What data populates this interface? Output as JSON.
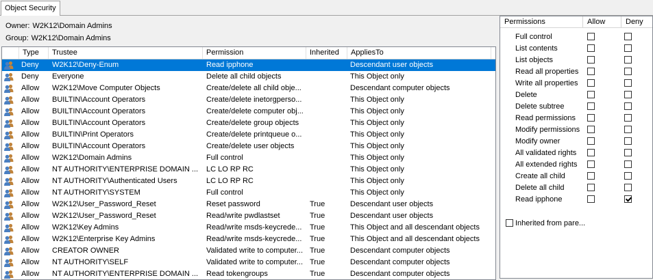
{
  "tab": {
    "label": "Object Security"
  },
  "owner": {
    "label": "Owner:",
    "value": "W2K12\\Domain Admins"
  },
  "group": {
    "label": "Group:",
    "value": "W2K12\\Domain Admins"
  },
  "columns": [
    "Type",
    "Trustee",
    "Permission",
    "Inherited",
    "AppliesTo"
  ],
  "rows": [
    {
      "type": "Deny",
      "trustee": "W2K12\\Deny-Enum",
      "permission": "Read ipphone",
      "inherited": "",
      "applies": "Descendant user objects",
      "selected": true
    },
    {
      "type": "Deny",
      "trustee": "Everyone",
      "permission": "Delete all child objects",
      "inherited": "",
      "applies": "This Object only"
    },
    {
      "type": "Allow",
      "trustee": "W2K12\\Move Computer Objects",
      "permission": "Create/delete all child obje...",
      "inherited": "",
      "applies": "Descendant computer objects"
    },
    {
      "type": "Allow",
      "trustee": "BUILTIN\\Account Operators",
      "permission": "Create/delete inetorgperso...",
      "inherited": "",
      "applies": "This Object only"
    },
    {
      "type": "Allow",
      "trustee": "BUILTIN\\Account Operators",
      "permission": "Create/delete computer obj...",
      "inherited": "",
      "applies": "This Object only"
    },
    {
      "type": "Allow",
      "trustee": "BUILTIN\\Account Operators",
      "permission": "Create/delete group objects",
      "inherited": "",
      "applies": "This Object only"
    },
    {
      "type": "Allow",
      "trustee": "BUILTIN\\Print Operators",
      "permission": "Create/delete printqueue o...",
      "inherited": "",
      "applies": "This Object only"
    },
    {
      "type": "Allow",
      "trustee": "BUILTIN\\Account Operators",
      "permission": "Create/delete user objects",
      "inherited": "",
      "applies": "This Object only"
    },
    {
      "type": "Allow",
      "trustee": "W2K12\\Domain Admins",
      "permission": "Full control",
      "inherited": "",
      "applies": "This Object only"
    },
    {
      "type": "Allow",
      "trustee": "NT AUTHORITY\\ENTERPRISE DOMAIN ...",
      "permission": "LC LO RP RC",
      "inherited": "",
      "applies": "This Object only"
    },
    {
      "type": "Allow",
      "trustee": "NT AUTHORITY\\Authenticated Users",
      "permission": "LC LO RP RC",
      "inherited": "",
      "applies": "This Object only"
    },
    {
      "type": "Allow",
      "trustee": "NT AUTHORITY\\SYSTEM",
      "permission": "Full control",
      "inherited": "",
      "applies": "This Object only"
    },
    {
      "type": "Allow",
      "trustee": "W2K12\\User_Password_Reset",
      "permission": "Reset password",
      "inherited": "True",
      "applies": "Descendant user objects"
    },
    {
      "type": "Allow",
      "trustee": "W2K12\\User_Password_Reset",
      "permission": "Read/write pwdlastset",
      "inherited": "True",
      "applies": "Descendant user objects"
    },
    {
      "type": "Allow",
      "trustee": "W2K12\\Key Admins",
      "permission": "Read/write msds-keycrede...",
      "inherited": "True",
      "applies": "This Object and all descendant objects"
    },
    {
      "type": "Allow",
      "trustee": "W2K12\\Enterprise Key Admins",
      "permission": "Read/write msds-keycrede...",
      "inherited": "True",
      "applies": "This Object and all descendant objects"
    },
    {
      "type": "Allow",
      "trustee": "CREATOR OWNER",
      "permission": "Validated write to computer...",
      "inherited": "True",
      "applies": "Descendant computer objects"
    },
    {
      "type": "Allow",
      "trustee": "NT AUTHORITY\\SELF",
      "permission": "Validated write to computer...",
      "inherited": "True",
      "applies": "Descendant computer objects"
    },
    {
      "type": "Allow",
      "trustee": "NT AUTHORITY\\ENTERPRISE DOMAIN ...",
      "permission": "Read tokengroups",
      "inherited": "True",
      "applies": "Descendant computer objects"
    }
  ],
  "permissions_panel": {
    "headers": [
      "Permissions",
      "Allow",
      "Deny"
    ],
    "items": [
      {
        "name": "Full control",
        "allow": false,
        "deny": false
      },
      {
        "name": "List contents",
        "allow": false,
        "deny": false
      },
      {
        "name": "List objects",
        "allow": false,
        "deny": false
      },
      {
        "name": "Read all properties",
        "allow": false,
        "deny": false
      },
      {
        "name": "Write all properties",
        "allow": false,
        "deny": false
      },
      {
        "name": "Delete",
        "allow": false,
        "deny": false
      },
      {
        "name": "Delete subtree",
        "allow": false,
        "deny": false
      },
      {
        "name": "Read permissions",
        "allow": false,
        "deny": false
      },
      {
        "name": "Modify permissions",
        "allow": false,
        "deny": false
      },
      {
        "name": "Modify owner",
        "allow": false,
        "deny": false
      },
      {
        "name": "All validated rights",
        "allow": false,
        "deny": false
      },
      {
        "name": "All extended rights",
        "allow": false,
        "deny": false
      },
      {
        "name": "Create all child",
        "allow": false,
        "deny": false
      },
      {
        "name": "Delete all child",
        "allow": false,
        "deny": false
      },
      {
        "name": "Read ipphone",
        "allow": false,
        "deny": true
      }
    ],
    "inherited_label": "Inherited from pare...",
    "inherited_checked": false
  },
  "colors": {
    "selection": "#0078d7",
    "user_icon_a": "#4a7fc1",
    "user_icon_b": "#c0843c"
  },
  "icons": {
    "trustee": "user-group-icon",
    "check": "checkbox-icon"
  }
}
